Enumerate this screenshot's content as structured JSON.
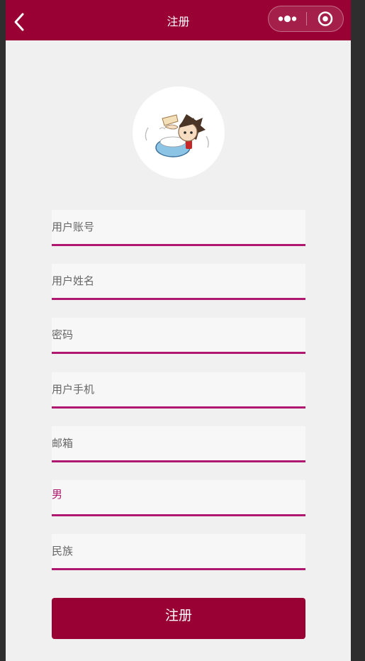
{
  "navbar": {
    "title": "注册",
    "back_icon": "chevron-left-icon",
    "more_icon": "more-dots-icon",
    "close_icon": "target-circle-icon"
  },
  "avatar": {
    "icon": "cartoon-avatar"
  },
  "form": {
    "username_placeholder": "用户账号",
    "realname_placeholder": "用户姓名",
    "password_placeholder": "密码",
    "phone_placeholder": "用户手机",
    "email_placeholder": "邮箱",
    "gender_value": "男",
    "ethnicity_placeholder": "民族"
  },
  "submit_label": "注册",
  "colors": {
    "brand": "#990033",
    "underline": "#b0176f",
    "page_bg": "#f0f0f0",
    "field_bg": "#f7f7f7"
  }
}
